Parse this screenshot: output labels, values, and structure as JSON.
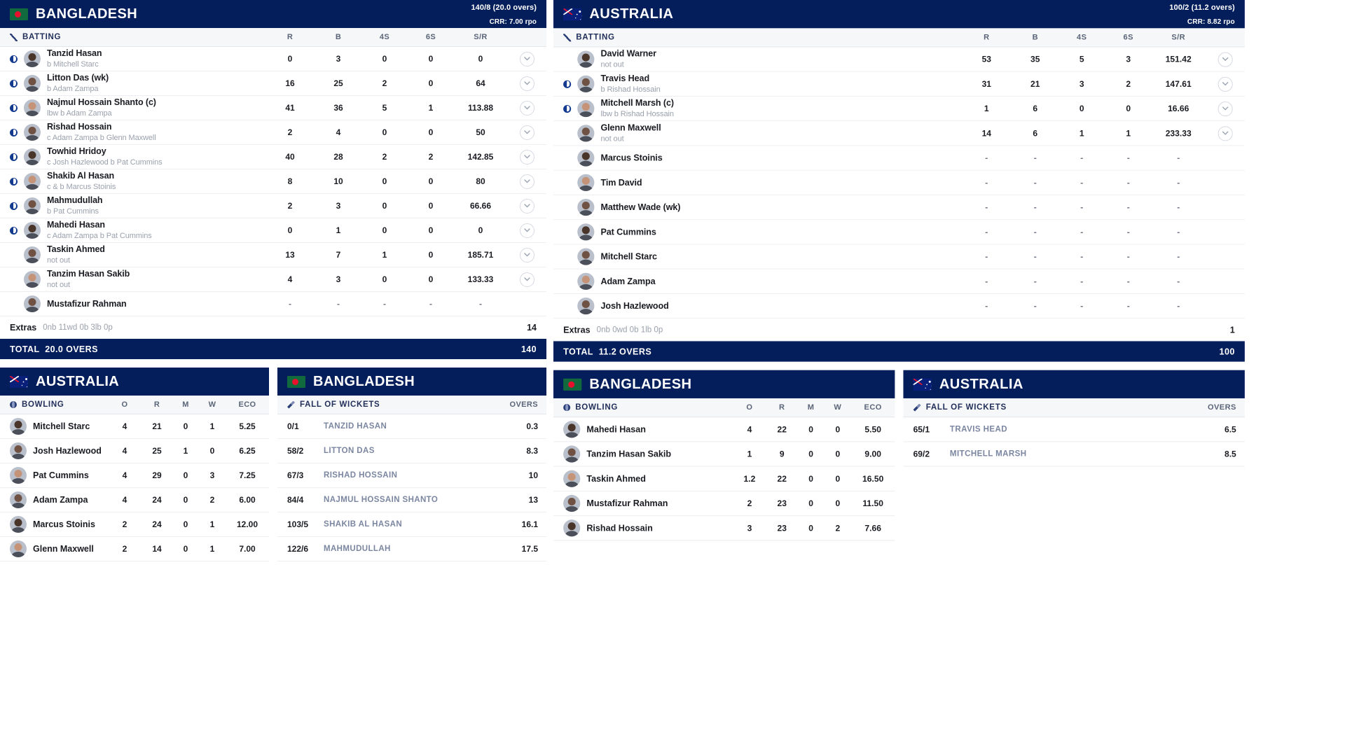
{
  "colors": {
    "brand_navy": "#041e5b",
    "accent_blue": "#123a8f",
    "muted": "#9aa1ad",
    "fow_name": "#7b86a0"
  },
  "left_panel": {
    "innings": {
      "team": "BANGLADESH",
      "flag": "bangladesh-flag-icon",
      "score_line1": "140/8 (20.0 overs)",
      "score_line2": "CRR: 7.00 rpo",
      "batting_label": "BATTING",
      "batting_icon": "bat-icon",
      "columns": [
        "R",
        "B",
        "4S",
        "6S",
        "S/R"
      ],
      "batters": [
        {
          "name": "Tanzid Hasan",
          "how": "b Mitchell Starc",
          "r": "0",
          "b": "3",
          "fours": "0",
          "sixes": "0",
          "sr": "0",
          "out": true
        },
        {
          "name": "Litton Das (wk)",
          "how": "b Adam Zampa",
          "r": "16",
          "b": "25",
          "fours": "2",
          "sixes": "0",
          "sr": "64",
          "out": true
        },
        {
          "name": "Najmul Hossain Shanto (c)",
          "how": "lbw b Adam Zampa",
          "r": "41",
          "b": "36",
          "fours": "5",
          "sixes": "1",
          "sr": "113.88",
          "out": true
        },
        {
          "name": "Rishad Hossain",
          "how": "c Adam Zampa b Glenn Maxwell",
          "r": "2",
          "b": "4",
          "fours": "0",
          "sixes": "0",
          "sr": "50",
          "out": true
        },
        {
          "name": "Towhid Hridoy",
          "how": "c Josh Hazlewood b Pat Cummins",
          "r": "40",
          "b": "28",
          "fours": "2",
          "sixes": "2",
          "sr": "142.85",
          "out": true
        },
        {
          "name": "Shakib Al Hasan",
          "how": "c & b Marcus Stoinis",
          "r": "8",
          "b": "10",
          "fours": "0",
          "sixes": "0",
          "sr": "80",
          "out": true
        },
        {
          "name": "Mahmudullah",
          "how": "b Pat Cummins",
          "r": "2",
          "b": "3",
          "fours": "0",
          "sixes": "0",
          "sr": "66.66",
          "out": true
        },
        {
          "name": "Mahedi Hasan",
          "how": "c Adam Zampa b Pat Cummins",
          "r": "0",
          "b": "1",
          "fours": "0",
          "sixes": "0",
          "sr": "0",
          "out": true
        },
        {
          "name": "Taskin Ahmed",
          "how": "not out",
          "r": "13",
          "b": "7",
          "fours": "1",
          "sixes": "0",
          "sr": "185.71",
          "out": false
        },
        {
          "name": "Tanzim Hasan Sakib",
          "how": "not out",
          "r": "4",
          "b": "3",
          "fours": "0",
          "sixes": "0",
          "sr": "133.33",
          "out": false
        },
        {
          "name": "Mustafizur Rahman",
          "how": "",
          "r": "-",
          "b": "-",
          "fours": "-",
          "sixes": "-",
          "sr": "-",
          "out": false,
          "no_chevron": true
        }
      ],
      "extras_label": "Extras",
      "extras_detail": "0nb 11wd 0b 3lb 0p",
      "extras_total": "14",
      "total_label": "TOTAL",
      "total_overs": "20.0 OVERS",
      "total_runs": "140"
    },
    "bowling_card": {
      "team": "AUSTRALIA",
      "flag": "australia-flag-icon",
      "label": "BOWLING",
      "icon": "ball-icon",
      "columns": [
        "O",
        "R",
        "M",
        "W",
        "ECO"
      ],
      "bowlers": [
        {
          "name": "Mitchell Starc",
          "o": "4",
          "r": "21",
          "m": "0",
          "w": "1",
          "eco": "5.25"
        },
        {
          "name": "Josh Hazlewood",
          "o": "4",
          "r": "25",
          "m": "1",
          "w": "0",
          "eco": "6.25"
        },
        {
          "name": "Pat Cummins",
          "o": "4",
          "r": "29",
          "m": "0",
          "w": "3",
          "eco": "7.25"
        },
        {
          "name": "Adam Zampa",
          "o": "4",
          "r": "24",
          "m": "0",
          "w": "2",
          "eco": "6.00"
        },
        {
          "name": "Marcus Stoinis",
          "o": "2",
          "r": "24",
          "m": "0",
          "w": "1",
          "eco": "12.00"
        },
        {
          "name": "Glenn Maxwell",
          "o": "2",
          "r": "14",
          "m": "0",
          "w": "1",
          "eco": "7.00"
        }
      ]
    },
    "fow_card": {
      "team": "BANGLADESH",
      "flag": "bangladesh-flag-icon",
      "label": "FALL OF WICKETS",
      "icon": "wicket-icon",
      "overs_header": "OVERS",
      "wickets": [
        {
          "score": "0/1",
          "name": "TANZID HASAN",
          "over": "0.3"
        },
        {
          "score": "58/2",
          "name": "LITTON DAS",
          "over": "8.3"
        },
        {
          "score": "67/3",
          "name": "RISHAD HOSSAIN",
          "over": "10"
        },
        {
          "score": "84/4",
          "name": "NAJMUL HOSSAIN SHANTO",
          "over": "13"
        },
        {
          "score": "103/5",
          "name": "SHAKIB AL HASAN",
          "over": "16.1"
        },
        {
          "score": "122/6",
          "name": "MAHMUDULLAH",
          "over": "17.5"
        }
      ]
    }
  },
  "right_panel": {
    "innings": {
      "team": "AUSTRALIA",
      "flag": "australia-flag-icon",
      "score_line1": "100/2 (11.2 overs)",
      "score_line2": "CRR: 8.82 rpo",
      "batting_label": "BATTING",
      "batting_icon": "bat-icon",
      "columns": [
        "R",
        "B",
        "4S",
        "6S",
        "S/R"
      ],
      "batters": [
        {
          "name": "David Warner",
          "how": "not out",
          "r": "53",
          "b": "35",
          "fours": "5",
          "sixes": "3",
          "sr": "151.42",
          "out": false
        },
        {
          "name": "Travis Head",
          "how": "b Rishad Hossain",
          "r": "31",
          "b": "21",
          "fours": "3",
          "sixes": "2",
          "sr": "147.61",
          "out": true
        },
        {
          "name": "Mitchell Marsh (c)",
          "how": "lbw b Rishad Hossain",
          "r": "1",
          "b": "6",
          "fours": "0",
          "sixes": "0",
          "sr": "16.66",
          "out": true
        },
        {
          "name": "Glenn Maxwell",
          "how": "not out",
          "r": "14",
          "b": "6",
          "fours": "1",
          "sixes": "1",
          "sr": "233.33",
          "out": false
        },
        {
          "name": "Marcus Stoinis",
          "how": "",
          "r": "-",
          "b": "-",
          "fours": "-",
          "sixes": "-",
          "sr": "-",
          "out": false,
          "no_chevron": true
        },
        {
          "name": "Tim David",
          "how": "",
          "r": "-",
          "b": "-",
          "fours": "-",
          "sixes": "-",
          "sr": "-",
          "out": false,
          "no_chevron": true
        },
        {
          "name": "Matthew Wade (wk)",
          "how": "",
          "r": "-",
          "b": "-",
          "fours": "-",
          "sixes": "-",
          "sr": "-",
          "out": false,
          "no_chevron": true
        },
        {
          "name": "Pat Cummins",
          "how": "",
          "r": "-",
          "b": "-",
          "fours": "-",
          "sixes": "-",
          "sr": "-",
          "out": false,
          "no_chevron": true
        },
        {
          "name": "Mitchell Starc",
          "how": "",
          "r": "-",
          "b": "-",
          "fours": "-",
          "sixes": "-",
          "sr": "-",
          "out": false,
          "no_chevron": true
        },
        {
          "name": "Adam Zampa",
          "how": "",
          "r": "-",
          "b": "-",
          "fours": "-",
          "sixes": "-",
          "sr": "-",
          "out": false,
          "no_chevron": true
        },
        {
          "name": "Josh Hazlewood",
          "how": "",
          "r": "-",
          "b": "-",
          "fours": "-",
          "sixes": "-",
          "sr": "-",
          "out": false,
          "no_chevron": true
        }
      ],
      "extras_label": "Extras",
      "extras_detail": "0nb 0wd 0b 1lb 0p",
      "extras_total": "1",
      "total_label": "TOTAL",
      "total_overs": "11.2 OVERS",
      "total_runs": "100"
    },
    "bowling_card": {
      "team": "BANGLADESH",
      "flag": "bangladesh-flag-icon",
      "label": "BOWLING",
      "icon": "ball-icon",
      "columns": [
        "O",
        "R",
        "M",
        "W",
        "ECO"
      ],
      "bowlers": [
        {
          "name": "Mahedi Hasan",
          "o": "4",
          "r": "22",
          "m": "0",
          "w": "0",
          "eco": "5.50"
        },
        {
          "name": "Tanzim Hasan Sakib",
          "o": "1",
          "r": "9",
          "m": "0",
          "w": "0",
          "eco": "9.00"
        },
        {
          "name": "Taskin Ahmed",
          "o": "1.2",
          "r": "22",
          "m": "0",
          "w": "0",
          "eco": "16.50"
        },
        {
          "name": "Mustafizur Rahman",
          "o": "2",
          "r": "23",
          "m": "0",
          "w": "0",
          "eco": "11.50"
        },
        {
          "name": "Rishad Hossain",
          "o": "3",
          "r": "23",
          "m": "0",
          "w": "2",
          "eco": "7.66"
        }
      ]
    },
    "fow_card": {
      "team": "AUSTRALIA",
      "flag": "australia-flag-icon",
      "label": "FALL OF WICKETS",
      "icon": "wicket-icon",
      "overs_header": "OVERS",
      "wickets": [
        {
          "score": "65/1",
          "name": "TRAVIS HEAD",
          "over": "6.5"
        },
        {
          "score": "69/2",
          "name": "MITCHELL MARSH",
          "over": "8.5"
        }
      ]
    }
  }
}
